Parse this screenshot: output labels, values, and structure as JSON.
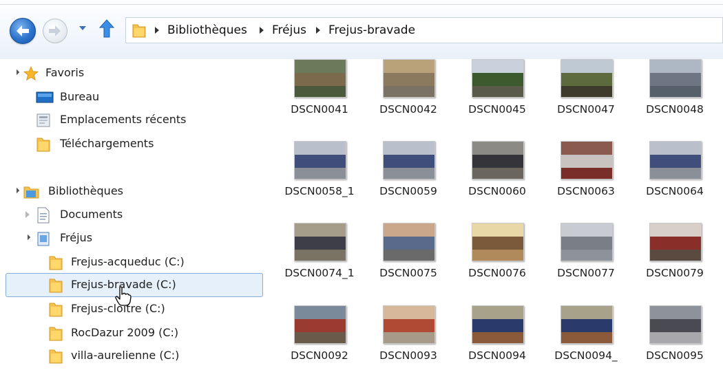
{
  "breadcrumb": [
    "Bibliothèques",
    "Fréjus",
    "Frejus-bravade"
  ],
  "nav": {
    "favorites_label": "Favoris",
    "favorites": [
      "Bureau",
      "Emplacements récents",
      "Téléchargements"
    ],
    "libraries_label": "Bibliothèques",
    "documents_label": "Documents",
    "frejus_label": "Fréjus",
    "frejus_children": [
      "Frejus-acqueduc (C:)",
      "Frejus-bravade (C:)",
      "Frejus-cloître (C:)",
      "RocDazur 2009 (C:)",
      "villa-aurelienne (C:)"
    ],
    "selected": "Frejus-bravade (C:)"
  },
  "files": [
    {
      "name": "DSCN0041",
      "thumb": "street"
    },
    {
      "name": "DSCN0042",
      "thumb": "shops"
    },
    {
      "name": "DSCN0045",
      "thumb": "trees"
    },
    {
      "name": "DSCN0047",
      "thumb": "palm"
    },
    {
      "name": "DSCN0048",
      "thumb": "road"
    },
    {
      "name": "DSCN0058_1",
      "thumb": "parade"
    },
    {
      "name": "DSCN0059",
      "thumb": "parade"
    },
    {
      "name": "DSCN0060",
      "thumb": "parade-dark"
    },
    {
      "name": "DSCN0063",
      "thumb": "parade-red"
    },
    {
      "name": "DSCN0064",
      "thumb": "parade"
    },
    {
      "name": "DSCN0074_1",
      "thumb": "crowd"
    },
    {
      "name": "DSCN0075",
      "thumb": "crowd-street"
    },
    {
      "name": "DSCN0076",
      "thumb": "sunny"
    },
    {
      "name": "DSCN0077",
      "thumb": "road-parade"
    },
    {
      "name": "DSCN0079",
      "thumb": "red-wall"
    },
    {
      "name": "DSCN0092",
      "thumb": "crowd-red"
    },
    {
      "name": "DSCN0093",
      "thumb": "square"
    },
    {
      "name": "DSCN0094",
      "thumb": "flags"
    },
    {
      "name": "DSCN0094_",
      "thumb": "flags"
    },
    {
      "name": "DSCN0095",
      "thumb": "crowd-gray"
    }
  ],
  "colors": {
    "selection_bg": "#e5f0fb",
    "selection_border": "#84acdd",
    "accent_blue": "#2c73cc"
  }
}
